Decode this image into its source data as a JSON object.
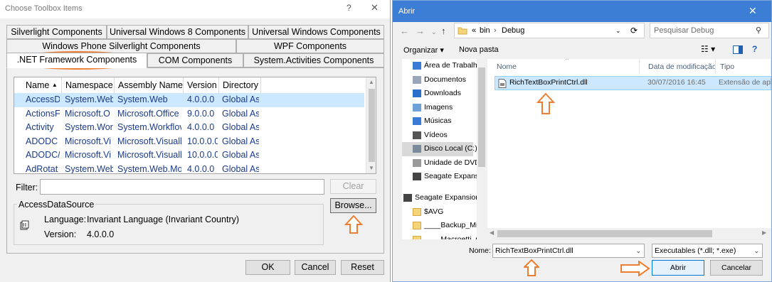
{
  "left_dialog": {
    "title": "Choose Toolbox Items",
    "help": "?",
    "close": "✕",
    "tabs": [
      {
        "label": "Silverlight Components"
      },
      {
        "label": "Universal Windows 8 Components"
      },
      {
        "label": "Universal Windows Components"
      },
      {
        "label": "Windows Phone Silverlight Components"
      },
      {
        "label": "WPF Components"
      },
      {
        "label": ".NET Framework Components"
      },
      {
        "label": "COM Components"
      },
      {
        "label": "System.Activities Components"
      }
    ],
    "active_tab": ".NET Framework Components",
    "columns": [
      {
        "label": "Name",
        "sort_indicator": "▲"
      },
      {
        "label": "Namespace"
      },
      {
        "label": "Assembly Name"
      },
      {
        "label": "Version"
      },
      {
        "label": "Directory"
      }
    ],
    "rows": [
      {
        "name": "AccessD",
        "namespace": "System.Web",
        "assembly": "System.Web",
        "version": "4.0.0.0",
        "directory": "Global As",
        "selected": true
      },
      {
        "name": "ActionsF",
        "namespace": "Microsoft.O",
        "assembly": "Microsoft.Office",
        "version": "9.0.0.0",
        "directory": "Global As"
      },
      {
        "name": "Activity",
        "namespace": "System.Wor",
        "assembly": "System.Workflov",
        "version": "4.0.0.0",
        "directory": "Global As"
      },
      {
        "name": "ADODC",
        "namespace": "Microsoft.Vi",
        "assembly": "Microsoft.Visuall",
        "version": "10.0.0.0",
        "directory": "Global As"
      },
      {
        "name": "ADODC/",
        "namespace": "Microsoft.Vi",
        "assembly": "Microsoft.Visuall",
        "version": "10.0.0.0",
        "directory": "Global As"
      },
      {
        "name": "AdRotat",
        "namespace": "System.Web",
        "assembly": "System.Web.Mol",
        "version": "4.0.0.0",
        "directory": "Global As"
      }
    ],
    "filter_label": "Filter:",
    "filter_value": "",
    "clear_button": "Clear",
    "group_title": "AccessDataSource",
    "language_label": "Language:",
    "language_value": "Invariant Language (Invariant Country)",
    "version_label": "Version:",
    "version_value": "4.0.0.0",
    "browse_button": "Browse...",
    "ok_button": "OK",
    "cancel_button": "Cancel",
    "reset_button": "Reset"
  },
  "right_dialog": {
    "title": "Abrir",
    "close": "✕",
    "path": {
      "prefix": "«",
      "parts": [
        "bin",
        "Debug"
      ],
      "separator": "›"
    },
    "search_placeholder": "Pesquisar Debug",
    "toolbar": {
      "organize": "Organizar ▾",
      "new_folder": "Nova pasta"
    },
    "nav_items": [
      {
        "label": "Área de Trabalho",
        "icon": "desktop-icon"
      },
      {
        "label": "Documentos",
        "icon": "documents-icon"
      },
      {
        "label": "Downloads",
        "icon": "downloads-icon"
      },
      {
        "label": "Imagens",
        "icon": "pictures-icon"
      },
      {
        "label": "Músicas",
        "icon": "music-icon"
      },
      {
        "label": "Vídeos",
        "icon": "videos-icon"
      },
      {
        "label": "Disco Local (C:)",
        "icon": "drive-icon",
        "selected": true
      },
      {
        "label": "Unidade de DVD",
        "icon": "dvd-icon"
      },
      {
        "label": "Seagate Expansion",
        "icon": "usb-drive-icon"
      },
      {
        "label": "",
        "icon": ""
      },
      {
        "label": "Seagate Expansion",
        "icon": "usb-drive-icon"
      },
      {
        "label": "$AVG",
        "icon": "folder-icon"
      },
      {
        "label": "____Backup_Mic",
        "icon": "folder-icon"
      },
      {
        "label": "____Macroetti_Gr",
        "icon": "folder-icon"
      }
    ],
    "file_columns": [
      "Nome",
      "Data de modificação",
      "Tipo"
    ],
    "files": [
      {
        "name": "RichTextBoxPrintCtrl.dll",
        "date": "30/07/2016 16:45",
        "type": "Extensão de aplicativo"
      }
    ],
    "filename_label": "Nome:",
    "filename_value": "RichTextBoxPrintCtrl.dll",
    "filter_value": "Executables (*.dll; *.exe)",
    "open_button": "Abrir",
    "cancel_button": "Cancelar"
  },
  "colors": {
    "highlight": "#ed7d31",
    "selection": "#cce8ff",
    "title_blue": "#3c7dd6"
  }
}
